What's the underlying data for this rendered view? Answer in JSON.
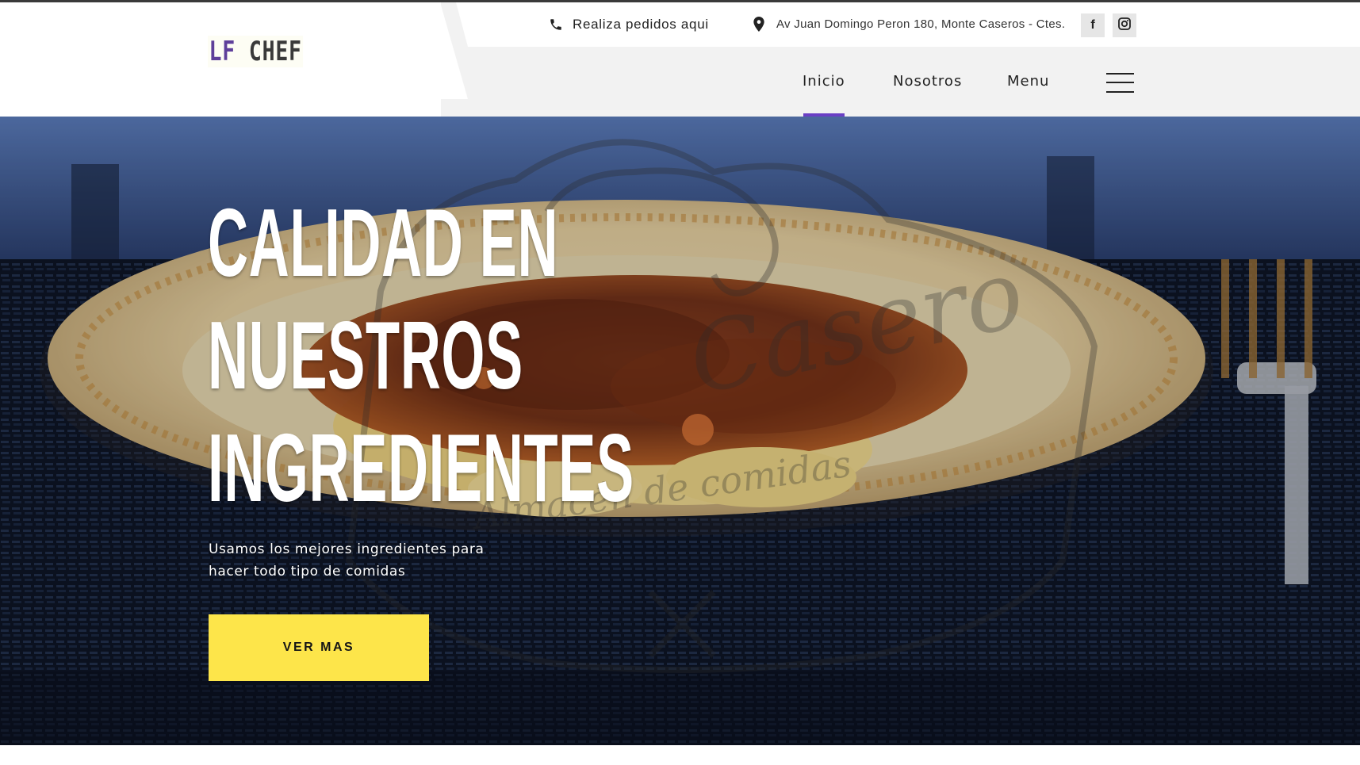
{
  "brand": {
    "logo_prefix": "LF",
    "logo_suffix": "CHEF"
  },
  "topbar": {
    "phone_text": "Realiza pedidos aqui",
    "address_text": "Av Juan Domingo Peron 180, Monte Caseros - Ctes."
  },
  "social": {
    "facebook_glyph": "f",
    "icons": [
      "facebook-icon",
      "instagram-icon"
    ]
  },
  "nav": {
    "items": [
      "Inicio",
      "Nosotros",
      "Menu"
    ],
    "active": "Inicio",
    "accent_color": "#6a3fc4"
  },
  "hero": {
    "title_lines": [
      "CALIDAD EN",
      "NUESTROS",
      "INGREDIENTES"
    ],
    "subtitle_line1": "Usamos los mejores ingredientes para",
    "subtitle_line2": "hacer todo tipo de comidas",
    "button_label": "VER MAS",
    "button_color": "#fde54a",
    "watermark_script": "Casero",
    "watermark_tagline": "Almacén de comidas"
  }
}
